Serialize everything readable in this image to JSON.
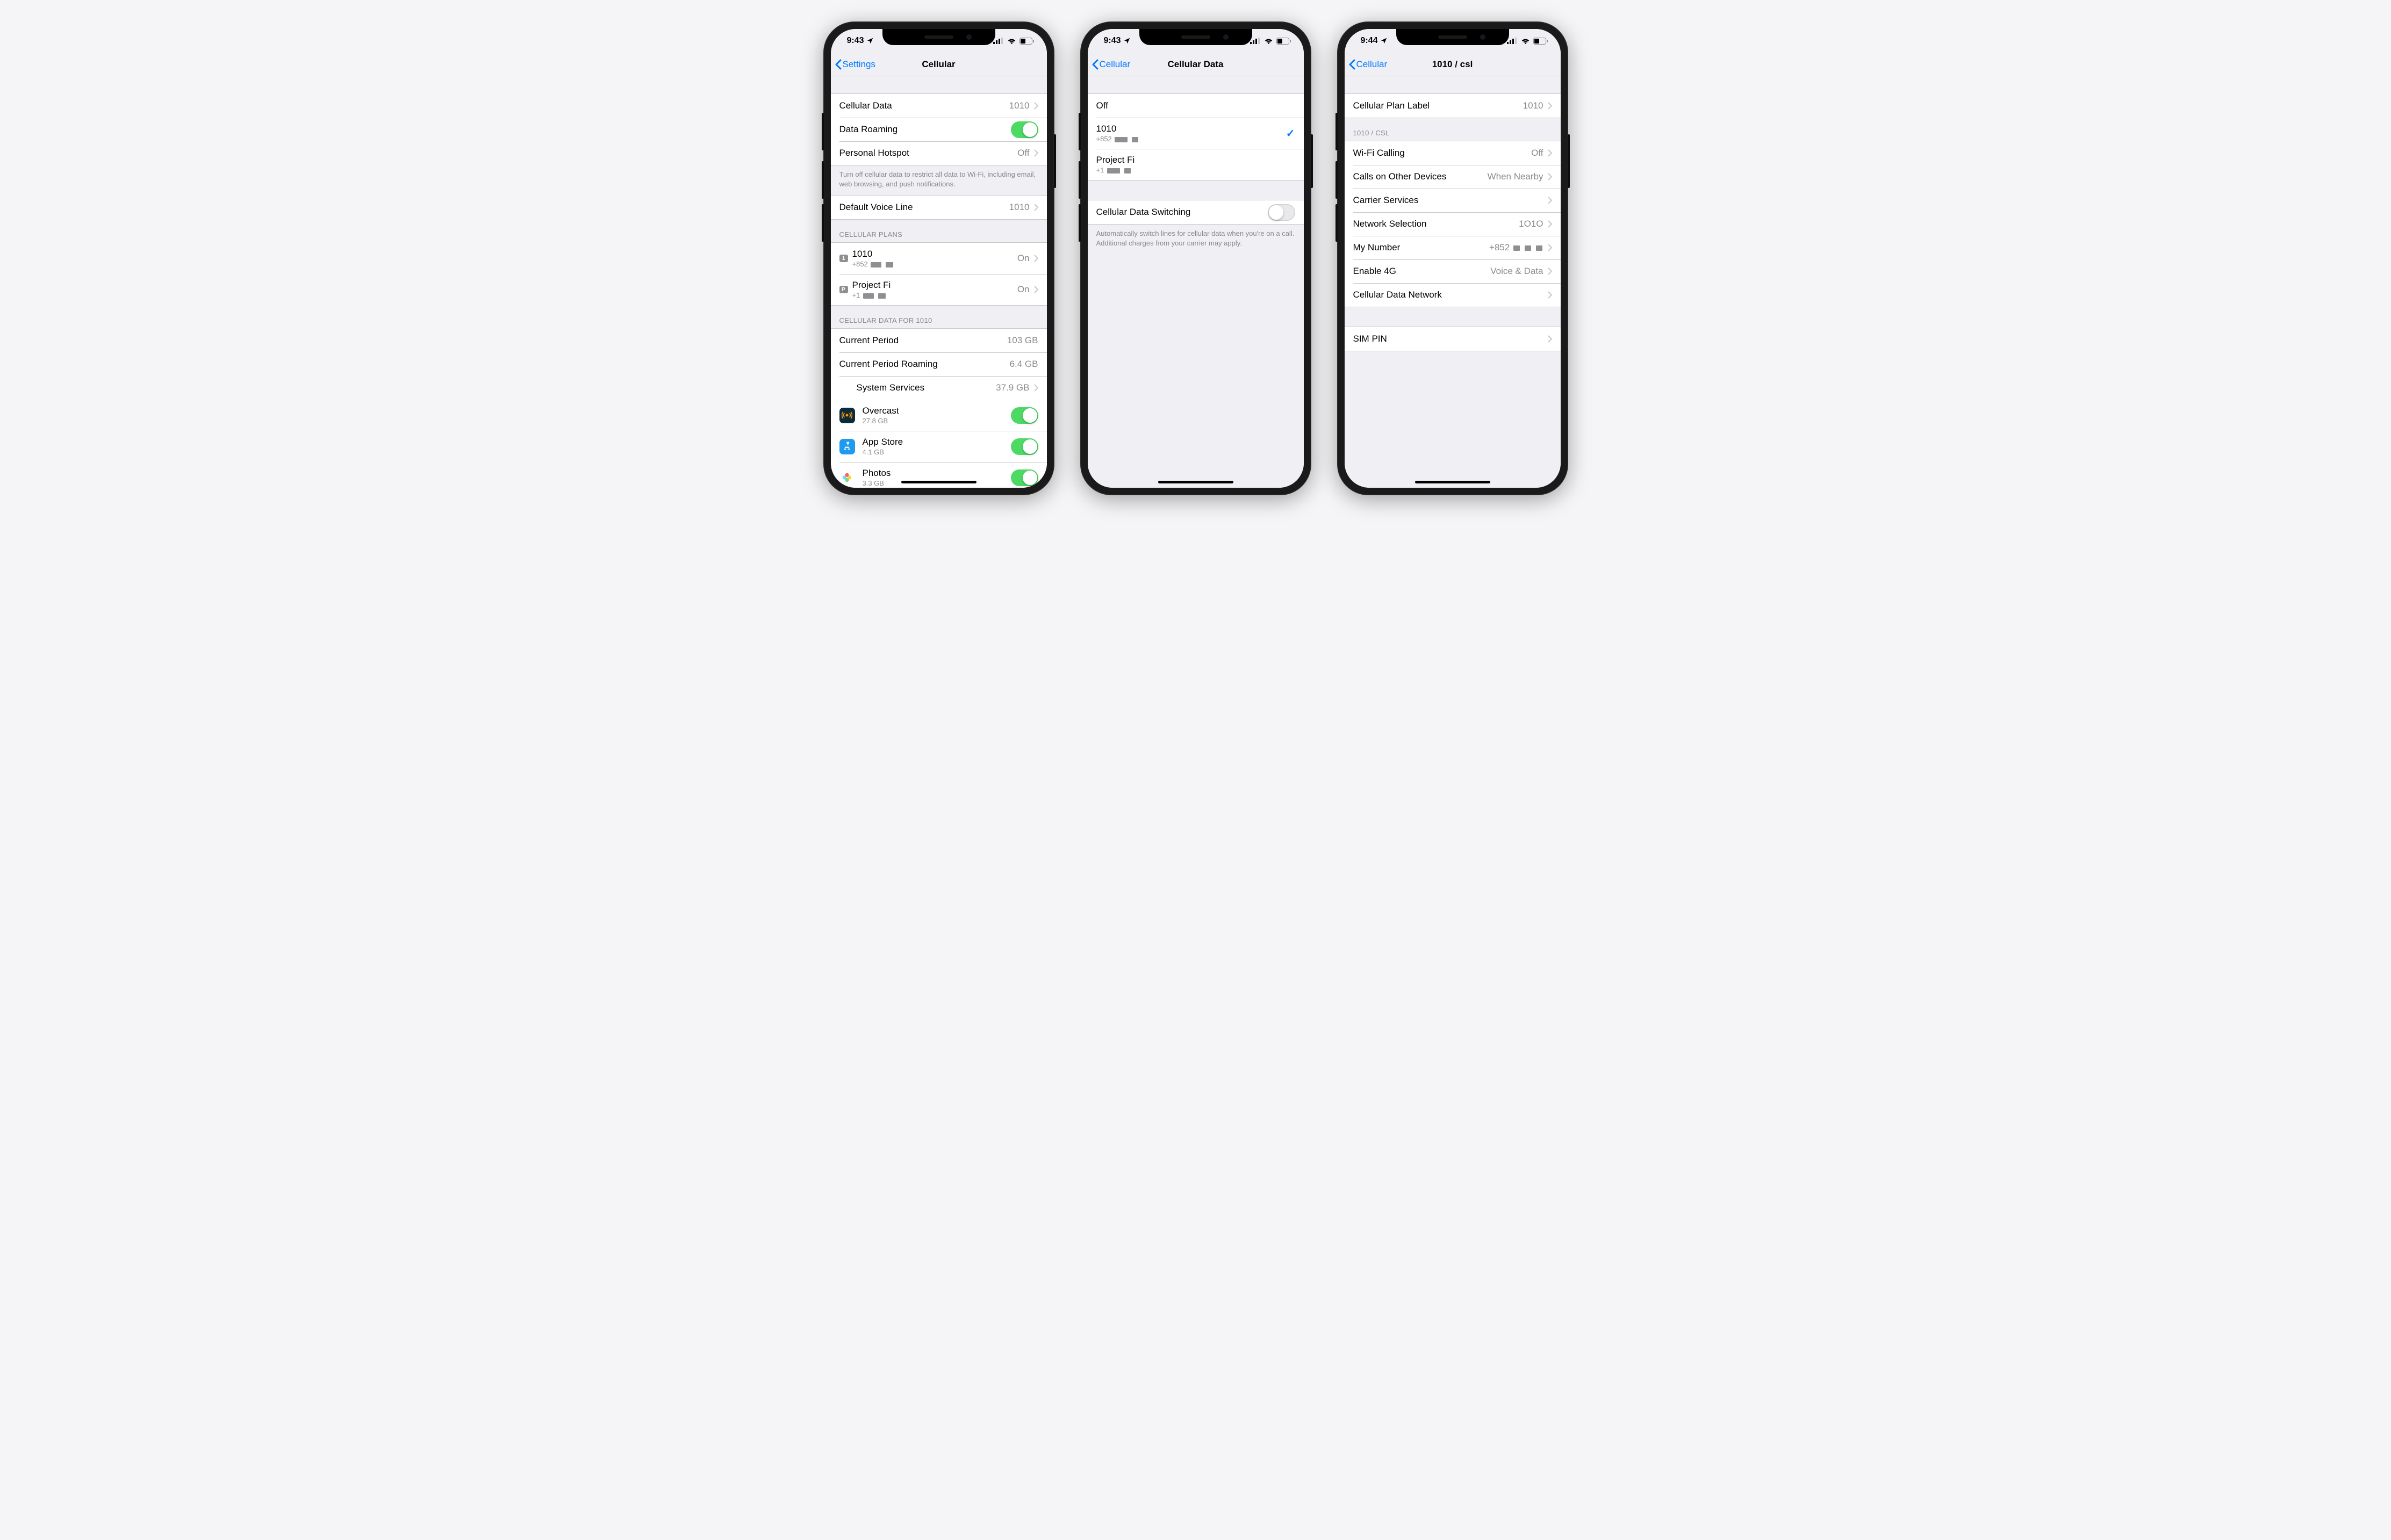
{
  "status": {
    "time_a": "9:43",
    "time_b": "9:43",
    "time_c": "9:44"
  },
  "screen1": {
    "back": "Settings",
    "title": "Cellular",
    "rows": {
      "cellular_data": {
        "label": "Cellular Data",
        "value": "1010"
      },
      "data_roaming": {
        "label": "Data Roaming",
        "on": true
      },
      "hotspot": {
        "label": "Personal Hotspot",
        "value": "Off"
      },
      "footer1": "Turn off cellular data to restrict all data to Wi-Fi, including email, web browsing, and push notifications.",
      "voice_line": {
        "label": "Default Voice Line",
        "value": "1010"
      }
    },
    "plans_header": "CELLULAR PLANS",
    "plans": [
      {
        "badge": "1",
        "name": "1010",
        "number": "+852",
        "status": "On"
      },
      {
        "badge": "P",
        "name": "Project Fi",
        "number": "+1",
        "status": "On"
      }
    ],
    "usage_header": "CELLULAR DATA FOR 1010",
    "usage": {
      "current": {
        "label": "Current Period",
        "value": "103 GB"
      },
      "roaming": {
        "label": "Current Period Roaming",
        "value": "6.4 GB"
      },
      "system": {
        "label": "System Services",
        "value": "37.9 GB"
      }
    },
    "apps": [
      {
        "name": "Overcast",
        "size": "27.8 GB",
        "on": true,
        "color": "#0b2a3a"
      },
      {
        "name": "App Store",
        "size": "4.1 GB",
        "on": true,
        "color": "#1e9bf0"
      },
      {
        "name": "Photos",
        "size": "3.3 GB",
        "on": true,
        "color": "#ffffff"
      }
    ]
  },
  "screen2": {
    "back": "Cellular",
    "title": "Cellular Data",
    "options": [
      {
        "label": "Off",
        "sub": "",
        "selected": false
      },
      {
        "label": "1010",
        "sub": "+852",
        "selected": true
      },
      {
        "label": "Project Fi",
        "sub": "+1",
        "selected": false
      }
    ],
    "switching": {
      "label": "Cellular Data Switching",
      "on": false
    },
    "footer": "Automatically switch lines for cellular data when you're on a call. Additional charges from your carrier may apply."
  },
  "screen3": {
    "back": "Cellular",
    "title": "1010 / csl",
    "plan_label": {
      "label": "Cellular Plan Label",
      "value": "1010"
    },
    "section_header": "1010 / CSL",
    "rows": [
      {
        "label": "Wi-Fi Calling",
        "value": "Off"
      },
      {
        "label": "Calls on Other Devices",
        "value": "When Nearby"
      },
      {
        "label": "Carrier Services",
        "value": ""
      },
      {
        "label": "Network Selection",
        "value": "1O1O"
      },
      {
        "label": "My Number",
        "value": "+852"
      },
      {
        "label": "Enable 4G",
        "value": "Voice & Data"
      },
      {
        "label": "Cellular Data Network",
        "value": ""
      }
    ],
    "sim_pin": {
      "label": "SIM PIN"
    }
  }
}
